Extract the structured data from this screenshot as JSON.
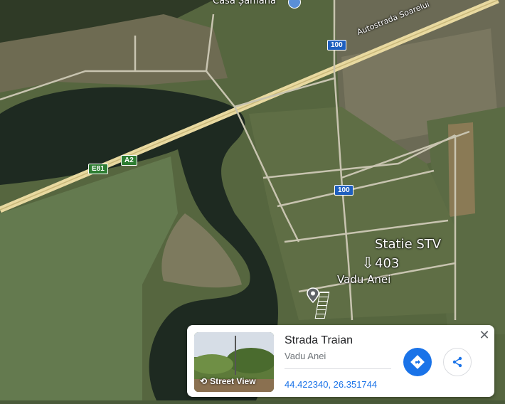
{
  "map": {
    "labels": {
      "casa_samana": "Casa Șamana",
      "autostrada": "Autostrada Soarelui",
      "statie": "Statie STV",
      "statie_num": "403",
      "vadu_anei": "Vadu Anei"
    },
    "shields": {
      "road_100_top": "100",
      "road_100_mid": "100",
      "e81": "E81",
      "a2": "A2"
    },
    "colors": {
      "river": "#1f2a22",
      "field": "#6b7f50",
      "road": "#e8d9a0"
    }
  },
  "place_card": {
    "title": "Strada Traian",
    "subtitle": "Vadu Anei",
    "coordinates": "44.422340, 26.351744",
    "street_view_label": "Street View",
    "close_icon": "close-icon",
    "directions_icon": "directions-icon",
    "share_icon": "share-icon",
    "accent_color": "#1a73e8"
  }
}
